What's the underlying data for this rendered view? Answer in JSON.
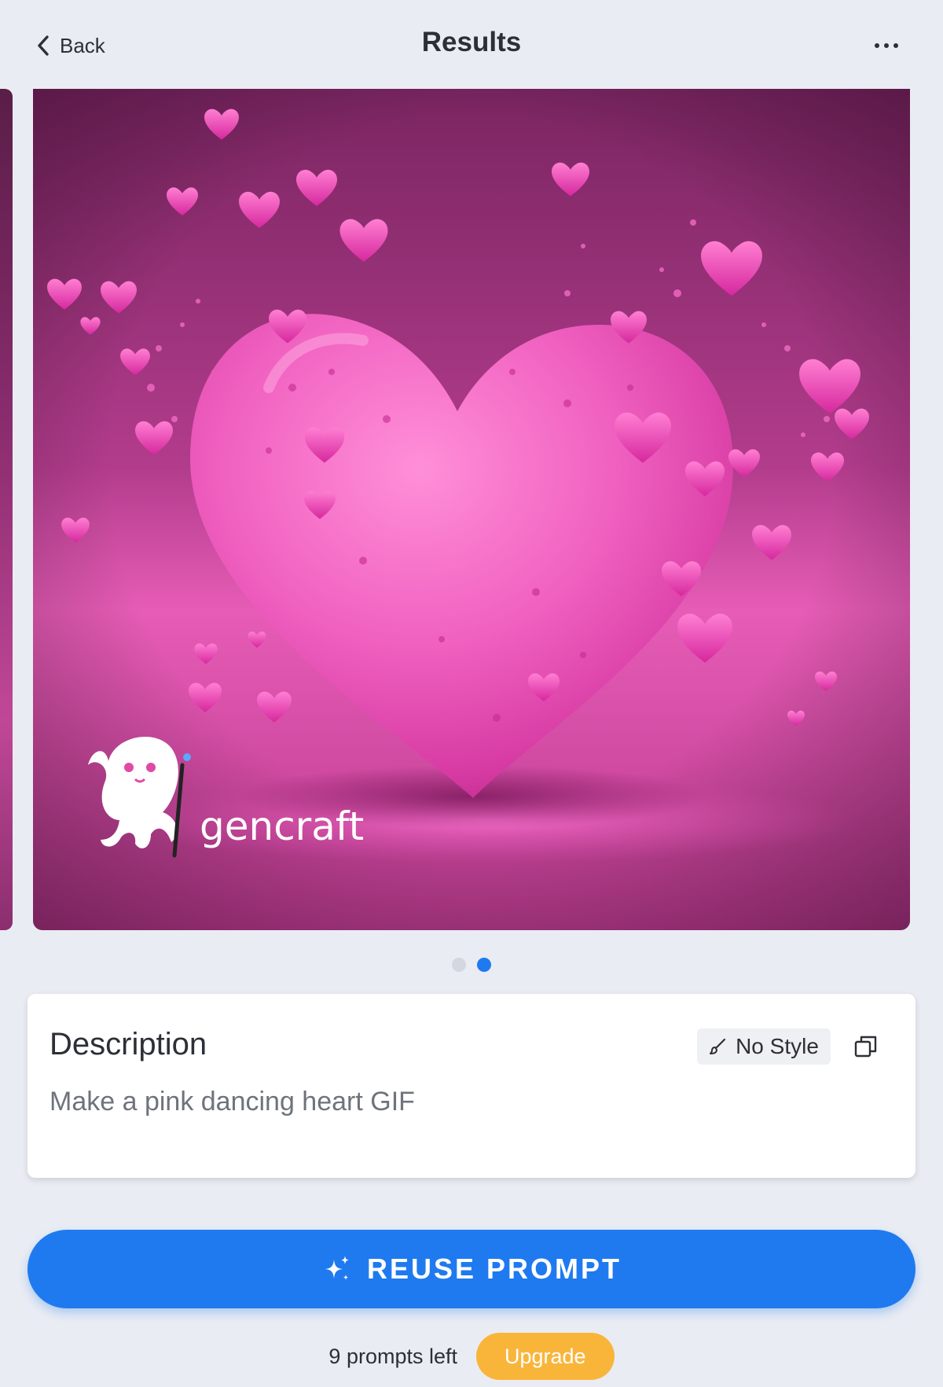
{
  "header": {
    "back_label": "Back",
    "title": "Results"
  },
  "carousel": {
    "watermark_text": "gencraft",
    "page_count": 2,
    "active_page": 2
  },
  "description_card": {
    "title": "Description",
    "style_label": "No Style",
    "prompt_text": "Make a pink dancing heart GIF"
  },
  "actions": {
    "reuse_label": "REUSE PROMPT"
  },
  "footer": {
    "prompts_left": "9 prompts left",
    "upgrade_label": "Upgrade"
  },
  "colors": {
    "accent": "#1f7af0",
    "upgrade": "#f9b53a",
    "background": "#e9ecf3",
    "artwork_pink": "#e0359f"
  }
}
